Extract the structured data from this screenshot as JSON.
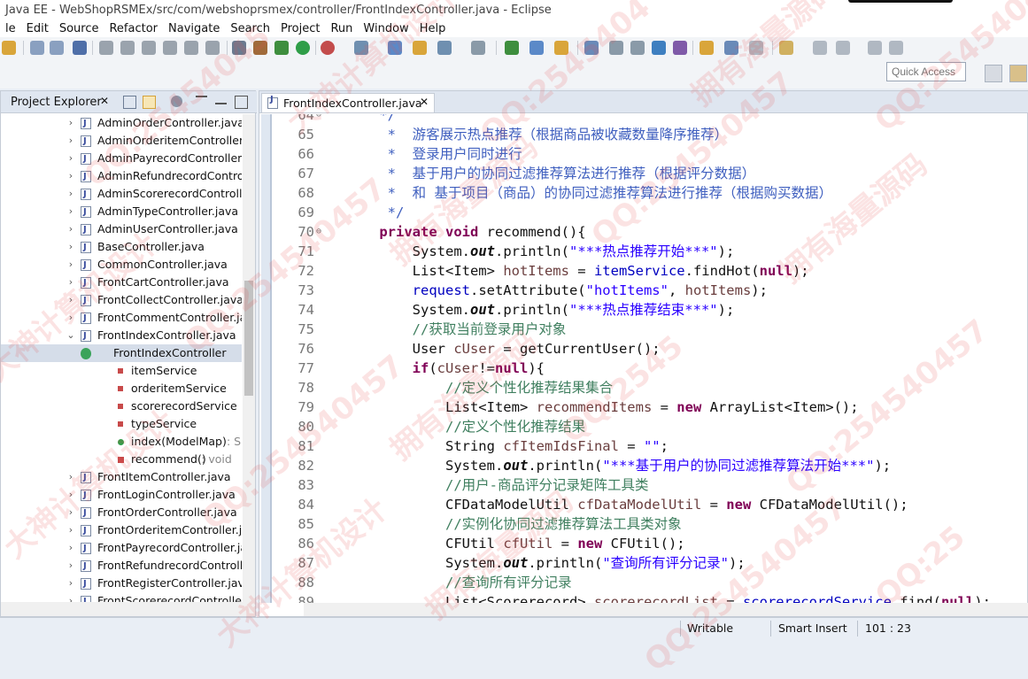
{
  "window": {
    "title": "Java EE - WebShopRSMEx/src/com/webshoprsmex/controller/FrontIndexController.java - Eclipse"
  },
  "menu": [
    "le",
    "Edit",
    "Source",
    "Refactor",
    "Navigate",
    "Search",
    "Project",
    "Run",
    "Window",
    "Help"
  ],
  "quick_access": {
    "placeholder": "Quick Access"
  },
  "explorer": {
    "title": "Project Explorer",
    "close": "✕",
    "items": [
      {
        "label": "AdminOrderController.java",
        "kind": "file",
        "depth": 0,
        "arrow": "›"
      },
      {
        "label": "AdminOrderitemController.j",
        "kind": "file",
        "depth": 0,
        "arrow": "›"
      },
      {
        "label": "AdminPayrecordController.j",
        "kind": "file",
        "depth": 0,
        "arrow": "›"
      },
      {
        "label": "AdminRefundrecordControl",
        "kind": "file",
        "depth": 0,
        "arrow": "›"
      },
      {
        "label": "AdminScorerecordControlle",
        "kind": "file",
        "depth": 0,
        "arrow": "›"
      },
      {
        "label": "AdminTypeController.java",
        "kind": "file",
        "depth": 0,
        "arrow": "›"
      },
      {
        "label": "AdminUserController.java",
        "kind": "file",
        "depth": 0,
        "arrow": "›"
      },
      {
        "label": "BaseController.java",
        "kind": "file",
        "depth": 0,
        "arrow": "›"
      },
      {
        "label": "CommonController.java",
        "kind": "file",
        "depth": 0,
        "arrow": "›"
      },
      {
        "label": "FrontCartController.java",
        "kind": "file",
        "depth": 0,
        "arrow": "›"
      },
      {
        "label": "FrontCollectController.java",
        "kind": "file",
        "depth": 0,
        "arrow": "›"
      },
      {
        "label": "FrontCommentController.jav",
        "kind": "file",
        "depth": 0,
        "arrow": "›"
      },
      {
        "label": "FrontIndexController.java",
        "kind": "file",
        "depth": 0,
        "arrow": "⌄"
      },
      {
        "label": "FrontIndexController",
        "kind": "class",
        "depth": 1,
        "arrow": "⌄",
        "selected": true
      },
      {
        "label": "itemService",
        "kind": "field",
        "depth": 2,
        "arrow": ""
      },
      {
        "label": "orderitemService",
        "kind": "field",
        "depth": 2,
        "arrow": ""
      },
      {
        "label": "scorerecordService",
        "kind": "field",
        "depth": 2,
        "arrow": ""
      },
      {
        "label": "typeService",
        "kind": "field",
        "depth": 2,
        "arrow": ""
      },
      {
        "label": "index(ModelMap)",
        "suffix": " : S",
        "kind": "method-public",
        "depth": 2,
        "arrow": ""
      },
      {
        "label": "recommend()",
        "suffix": " : void",
        "kind": "method-private",
        "depth": 2,
        "arrow": ""
      },
      {
        "label": "FrontItemController.java",
        "kind": "file",
        "depth": 0,
        "arrow": "›"
      },
      {
        "label": "FrontLoginController.java",
        "kind": "file",
        "depth": 0,
        "arrow": "›"
      },
      {
        "label": "FrontOrderController.java",
        "kind": "file",
        "depth": 0,
        "arrow": "›"
      },
      {
        "label": "FrontOrderitemController.ja",
        "kind": "file",
        "depth": 0,
        "arrow": "›"
      },
      {
        "label": "FrontPayrecordController.ja",
        "kind": "file",
        "depth": 0,
        "arrow": "›"
      },
      {
        "label": "FrontRefundrecordControlle",
        "kind": "file",
        "depth": 0,
        "arrow": "›"
      },
      {
        "label": "FrontRegisterController.java",
        "kind": "file",
        "depth": 0,
        "arrow": "›"
      },
      {
        "label": "FrontScorerecordControlle",
        "kind": "file",
        "depth": 0,
        "arrow": "›"
      }
    ]
  },
  "editor": {
    "tab": "FrontIndexController.java",
    "close": "✕",
    "lines": [
      {
        "n": "64",
        "fold": "⊖",
        "tokens": [
          [
            "jd",
            "    */"
          ]
        ]
      },
      {
        "n": "65",
        "tokens": [
          [
            "jd",
            "     *  游客展示热点推荐（根据商品被收藏数量降序推荐）"
          ]
        ]
      },
      {
        "n": "66",
        "tokens": [
          [
            "jd",
            "     *  登录用户同时进行"
          ]
        ]
      },
      {
        "n": "67",
        "tokens": [
          [
            "jd",
            "     *  基于用户的协同过滤推荐算法进行推荐（根据评分数据）"
          ]
        ]
      },
      {
        "n": "68",
        "tokens": [
          [
            "jd",
            "     *  和 基于项目（商品）的协同过滤推荐算法进行推荐（根据购买数据）"
          ]
        ]
      },
      {
        "n": "69",
        "tokens": [
          [
            "jd",
            "     */"
          ]
        ]
      },
      {
        "n": "70",
        "fold": "⊖",
        "tokens": [
          [
            "",
            "    "
          ],
          [
            "kw",
            "private"
          ],
          [
            "",
            " "
          ],
          [
            "kw",
            "void"
          ],
          [
            "",
            " recommend(){"
          ]
        ]
      },
      {
        "n": "71",
        "tokens": [
          [
            "",
            "        System."
          ],
          [
            "it",
            "out"
          ],
          [
            "",
            ".println("
          ],
          [
            "st",
            "\"***热点推荐开始***\""
          ],
          [
            "",
            ");"
          ]
        ]
      },
      {
        "n": "72",
        "tokens": [
          [
            "",
            "        List<Item> "
          ],
          [
            "lv",
            "hotItems"
          ],
          [
            "",
            " = "
          ],
          [
            "fd",
            "itemService"
          ],
          [
            "",
            ".findHot("
          ],
          [
            "kw",
            "null"
          ],
          [
            "",
            ");"
          ]
        ]
      },
      {
        "n": "73",
        "tokens": [
          [
            "",
            "        "
          ],
          [
            "fd",
            "request"
          ],
          [
            "",
            ".setAttribute("
          ],
          [
            "st",
            "\"hotItems\""
          ],
          [
            "",
            ", "
          ],
          [
            "lv",
            "hotItems"
          ],
          [
            "",
            ");"
          ]
        ]
      },
      {
        "n": "74",
        "tokens": [
          [
            "",
            "        System."
          ],
          [
            "it",
            "out"
          ],
          [
            "",
            ".println("
          ],
          [
            "st",
            "\"***热点推荐结束***\""
          ],
          [
            "",
            ");"
          ]
        ]
      },
      {
        "n": "75",
        "tokens": [
          [
            "cm",
            "        //获取当前登录用户对象"
          ]
        ]
      },
      {
        "n": "76",
        "tokens": [
          [
            "",
            "        User "
          ],
          [
            "lv",
            "cUser"
          ],
          [
            "",
            " = getCurrentUser();"
          ]
        ]
      },
      {
        "n": "77",
        "tokens": [
          [
            "",
            "        "
          ],
          [
            "kw",
            "if"
          ],
          [
            "",
            "("
          ],
          [
            "lv",
            "cUser"
          ],
          [
            "",
            "!="
          ],
          [
            "kw",
            "null"
          ],
          [
            "",
            "){"
          ]
        ]
      },
      {
        "n": "78",
        "tokens": [
          [
            "cm",
            "            //定义个性化推荐结果集合"
          ]
        ]
      },
      {
        "n": "79",
        "tokens": [
          [
            "",
            "            List<Item> "
          ],
          [
            "lv",
            "recommendItems"
          ],
          [
            "",
            " = "
          ],
          [
            "kw",
            "new"
          ],
          [
            "",
            " ArrayList<Item>();"
          ]
        ]
      },
      {
        "n": "80",
        "tokens": [
          [
            "cm",
            "            //定义个性化推荐结果"
          ]
        ]
      },
      {
        "n": "81",
        "tokens": [
          [
            "",
            "            String "
          ],
          [
            "lv",
            "cfItemIdsFinal"
          ],
          [
            "",
            " = "
          ],
          [
            "st",
            "\"\""
          ],
          [
            "",
            ";"
          ]
        ]
      },
      {
        "n": "82",
        "tokens": [
          [
            "",
            "            System."
          ],
          [
            "it",
            "out"
          ],
          [
            "",
            ".println("
          ],
          [
            "st",
            "\"***基于用户的协同过滤推荐算法开始***\""
          ],
          [
            "",
            ");"
          ]
        ]
      },
      {
        "n": "83",
        "tokens": [
          [
            "cm",
            "            //用户-商品评分记录矩阵工具类"
          ]
        ]
      },
      {
        "n": "84",
        "tokens": [
          [
            "",
            "            CFDataModelUtil "
          ],
          [
            "lv",
            "cfDataModelUtil"
          ],
          [
            "",
            " = "
          ],
          [
            "kw",
            "new"
          ],
          [
            "",
            " CFDataModelUtil();"
          ]
        ]
      },
      {
        "n": "85",
        "tokens": [
          [
            "cm",
            "            //实例化协同过滤推荐算法工具类对象"
          ]
        ]
      },
      {
        "n": "86",
        "tokens": [
          [
            "",
            "            CFUtil "
          ],
          [
            "lv",
            "cfUtil"
          ],
          [
            "",
            " = "
          ],
          [
            "kw",
            "new"
          ],
          [
            "",
            " CFUtil();"
          ]
        ]
      },
      {
        "n": "87",
        "tokens": [
          [
            "",
            "            System."
          ],
          [
            "it",
            "out"
          ],
          [
            "",
            ".println("
          ],
          [
            "st",
            "\"查询所有评分记录\""
          ],
          [
            "",
            ");"
          ]
        ]
      },
      {
        "n": "88",
        "tokens": [
          [
            "cm",
            "            //查询所有评分记录"
          ]
        ]
      },
      {
        "n": "89",
        "tokens": [
          [
            "",
            "            List<Scorerecord> "
          ],
          [
            "lv",
            "scorerecordList"
          ],
          [
            "",
            " = "
          ],
          [
            "fd",
            "scorerecordService"
          ],
          [
            "",
            ".find("
          ],
          [
            "kw",
            "null"
          ],
          [
            "",
            ");"
          ]
        ]
      }
    ]
  },
  "status": {
    "writable": "Writable",
    "insert_mode": "Smart Insert",
    "position": "101 : 23"
  },
  "watermarks": [
    "QQ:25454045",
    "大神计算机设计",
    "QQ:2545404",
    "拥有海量源码",
    "QQ:254540457",
    "大神计算机设计",
    "QQ:254540457",
    "拥有海量源码",
    "QQ:254540457",
    "拥有海量源码",
    "大神计算机设计",
    "QQ:254540457",
    "拥有海量源码",
    "QQ:2545",
    "QQ:254540457",
    "大神计算机设计",
    "拥有海量源码",
    "QQ:254540457",
    "QQ:25"
  ],
  "colors": {
    "keyword": "#7f0055",
    "comment": "#3f7f5f",
    "javadoc": "#3f5fbf",
    "string": "#2a00ff",
    "field": "#0000c0"
  }
}
